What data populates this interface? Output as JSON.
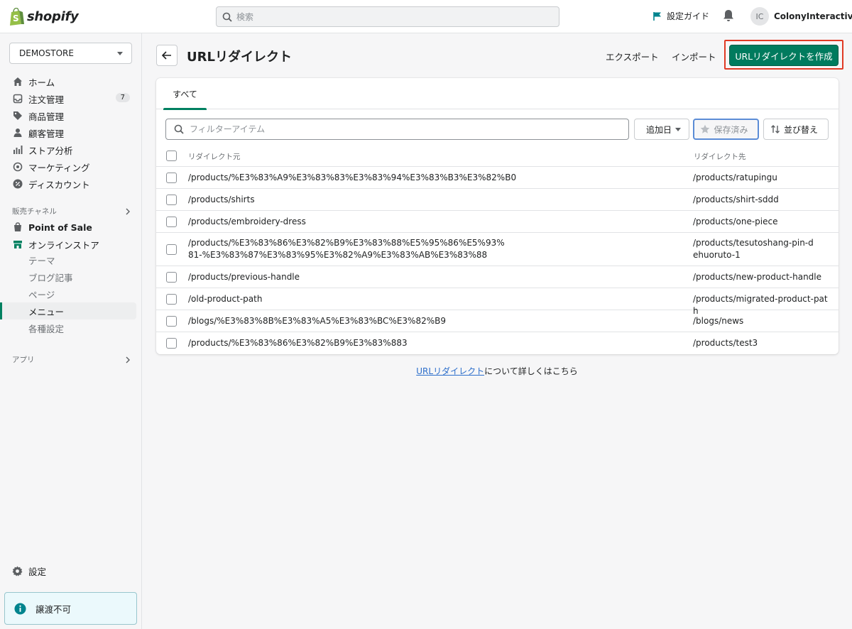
{
  "topbar": {
    "logo_text": "shopify",
    "search_placeholder": "検索",
    "guide_label": "設定ガイド",
    "avatar_initials": "IC",
    "user_name": "ColonyInteractive"
  },
  "sidebar": {
    "store_name": "DEMOSTORE",
    "nav": [
      {
        "label": "ホーム",
        "icon": "home-icon"
      },
      {
        "label": "注文管理",
        "icon": "orders-icon",
        "badge": "7"
      },
      {
        "label": "商品管理",
        "icon": "tag-icon"
      },
      {
        "label": "顧客管理",
        "icon": "person-icon"
      },
      {
        "label": "ストア分析",
        "icon": "bar-chart-icon"
      },
      {
        "label": "マーケティング",
        "icon": "target-icon"
      },
      {
        "label": "ディスカウント",
        "icon": "discount-icon"
      }
    ],
    "sales_channels_label": "販売チャネル",
    "channels": [
      {
        "label": "Point of Sale",
        "icon": "bag-icon"
      },
      {
        "label": "オンラインストア",
        "icon": "store-icon"
      }
    ],
    "store_sub": [
      {
        "label": "テーマ"
      },
      {
        "label": "ブログ記事"
      },
      {
        "label": "ページ"
      },
      {
        "label": "メニュー",
        "active": true
      },
      {
        "label": "各種設定"
      }
    ],
    "apps_label": "アプリ",
    "settings_label": "設定",
    "notice_label": "譲渡不可"
  },
  "page": {
    "title": "URLリダイレクト",
    "export_label": "エクスポート",
    "import_label": "インポート",
    "create_label": "URLリダイレクトを作成",
    "tab_all": "すべて",
    "filter_placeholder": "フィルターアイテム",
    "added_date_label": "追加日",
    "saved_label": "保存済み",
    "sort_label": "並び替え",
    "col_from": "リダイレクト元",
    "col_to": "リダイレクト先",
    "footer_link": "URLリダイレクト",
    "footer_rest": "について詳しくはこちら"
  },
  "rows": [
    {
      "from": "/products/%E3%83%A9%E3%83%83%E3%83%94%E3%83%B3%E3%82%B0",
      "to": "/products/ratupingu"
    },
    {
      "from": "/products/shirts",
      "to": "/products/shirt-sddd"
    },
    {
      "from": "/products/embroidery-dress",
      "to": "/products/one-piece"
    },
    {
      "from": "/products/%E3%83%86%E3%82%B9%E3%83%88%E5%95%86%E5%93%81-%E3%83%87%E3%83%95%E3%82%A9%E3%83%AB%E3%83%88",
      "to": "/products/tesutoshang-pin-dehuoruto-1"
    },
    {
      "from": "/products/previous-handle",
      "to": "/products/new-product-handle"
    },
    {
      "from": "/old-product-path",
      "to": "/products/migrated-product-path"
    },
    {
      "from": "/blogs/%E3%83%8B%E3%83%A5%E3%83%BC%E3%82%B9",
      "to": "/blogs/news"
    },
    {
      "from": "/products/%E3%83%86%E3%82%B9%E3%83%883",
      "to": "/products/test3"
    }
  ],
  "colors": {
    "primary": "#007b5e",
    "active_indicator": "#008060",
    "highlight_outline": "#e03a24",
    "link": "#2c6ecb"
  }
}
